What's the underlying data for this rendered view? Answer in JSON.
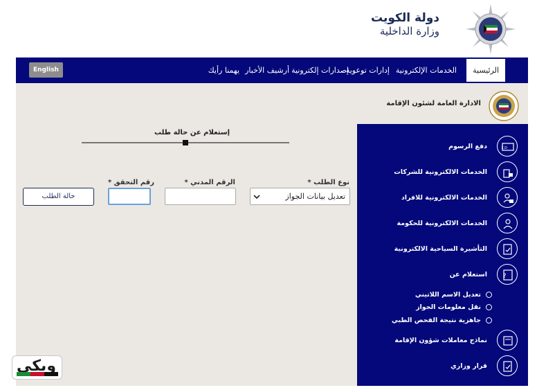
{
  "header": {
    "org_line1": "دولة الكويت",
    "org_line2": "وزارة الداخلية"
  },
  "nav": {
    "items": [
      "الرئيسية",
      "الخدمات الإلكترونية",
      "إدارات توعوية",
      "إصدارات إلكترونية",
      "أرشيف الأخبار",
      "يهمنا رأيك"
    ],
    "lang_button": "English"
  },
  "department": {
    "title": "الادارة العامة لشئون الإقامة"
  },
  "inquiry": {
    "title": "إستعلام عن حالة طلب"
  },
  "form": {
    "request_type_label": "نوع الطلب *",
    "request_type_value": "تعديل بيانات الجواز",
    "civil_id_label": "الرقم المدني *",
    "civil_id_value": "",
    "verify_label": "رقم التحقق *",
    "verify_value": "",
    "submit_label": "حالة الطلب"
  },
  "sidebar": {
    "items": [
      "دفع الرسوم",
      "الخدمات الالكترونية للشركات",
      "الخدمات الالكترونية للافراد",
      "الخدمات الالكترونية للحكومة",
      "التأشيرة السياحية الالكترونية",
      "استعلام عن"
    ],
    "sub_items": [
      "تعديل الاسم اللاتيني",
      "نقل معلومات الجواز",
      "جاهزية نتيجة الفحص الطبي"
    ],
    "bottom_items": [
      "نماذج معاملات شؤون الإقامة",
      "قرار وزاري"
    ]
  },
  "watermark": {
    "text": "ويكي"
  },
  "colors": {
    "nav_bg": "#04087a",
    "main_bg": "#ebe8e3",
    "accent": "#1c2a55"
  }
}
